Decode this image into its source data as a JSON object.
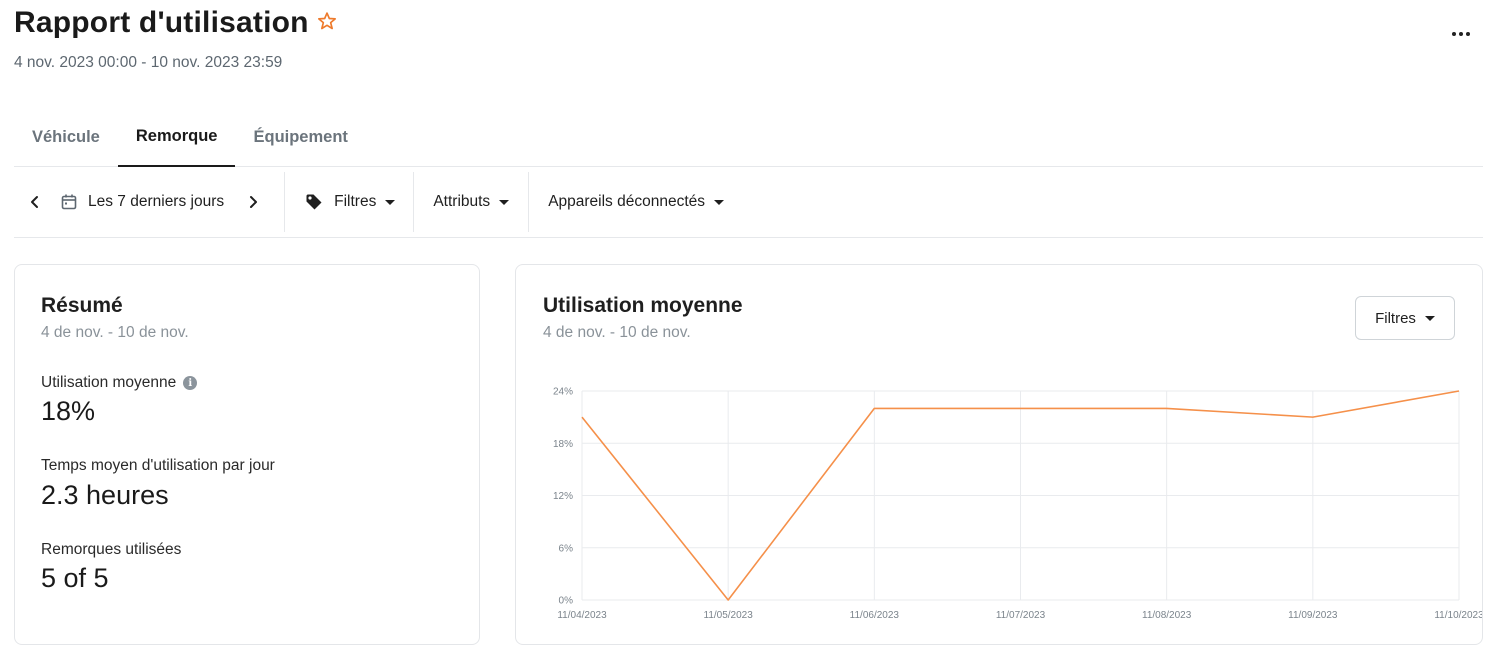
{
  "header": {
    "title": "Rapport d'utilisation",
    "date_range": "4 nov. 2023 00:00 - 10 nov. 2023 23:59"
  },
  "tabs": [
    {
      "label": "Véhicule",
      "active": false
    },
    {
      "label": "Remorque",
      "active": true
    },
    {
      "label": "Équipement",
      "active": false
    }
  ],
  "toolbar": {
    "period": "Les 7 derniers jours",
    "filters": "Filtres",
    "attributes": "Attributs",
    "disconnected": "Appareils déconnectés"
  },
  "summary": {
    "title": "Résumé",
    "subtitle": "4 de nov. - 10 de nov.",
    "metrics": [
      {
        "label": "Utilisation moyenne",
        "value": "18%"
      },
      {
        "label": "Temps moyen d'utilisation par jour",
        "value": "2.3 heures"
      },
      {
        "label": "Remorques utilisées",
        "value": "5 of 5"
      }
    ]
  },
  "usage": {
    "title": "Utilisation moyenne",
    "subtitle": "4 de nov. - 10 de nov.",
    "filter_label": "Filtres"
  },
  "colors": {
    "accent": "#f5904a",
    "star": "#ee7a2c"
  },
  "chart_data": {
    "type": "line",
    "x": [
      "11/04/2023",
      "11/05/2023",
      "11/06/2023",
      "11/07/2023",
      "11/08/2023",
      "11/09/2023",
      "11/10/2023"
    ],
    "series": [
      {
        "values": [
          21,
          0,
          22,
          22,
          22,
          21,
          24
        ]
      }
    ],
    "y_ticks": [
      "0%",
      "6%",
      "12%",
      "18%",
      "24%"
    ],
    "ylim": [
      0,
      24
    ],
    "grid": true
  }
}
